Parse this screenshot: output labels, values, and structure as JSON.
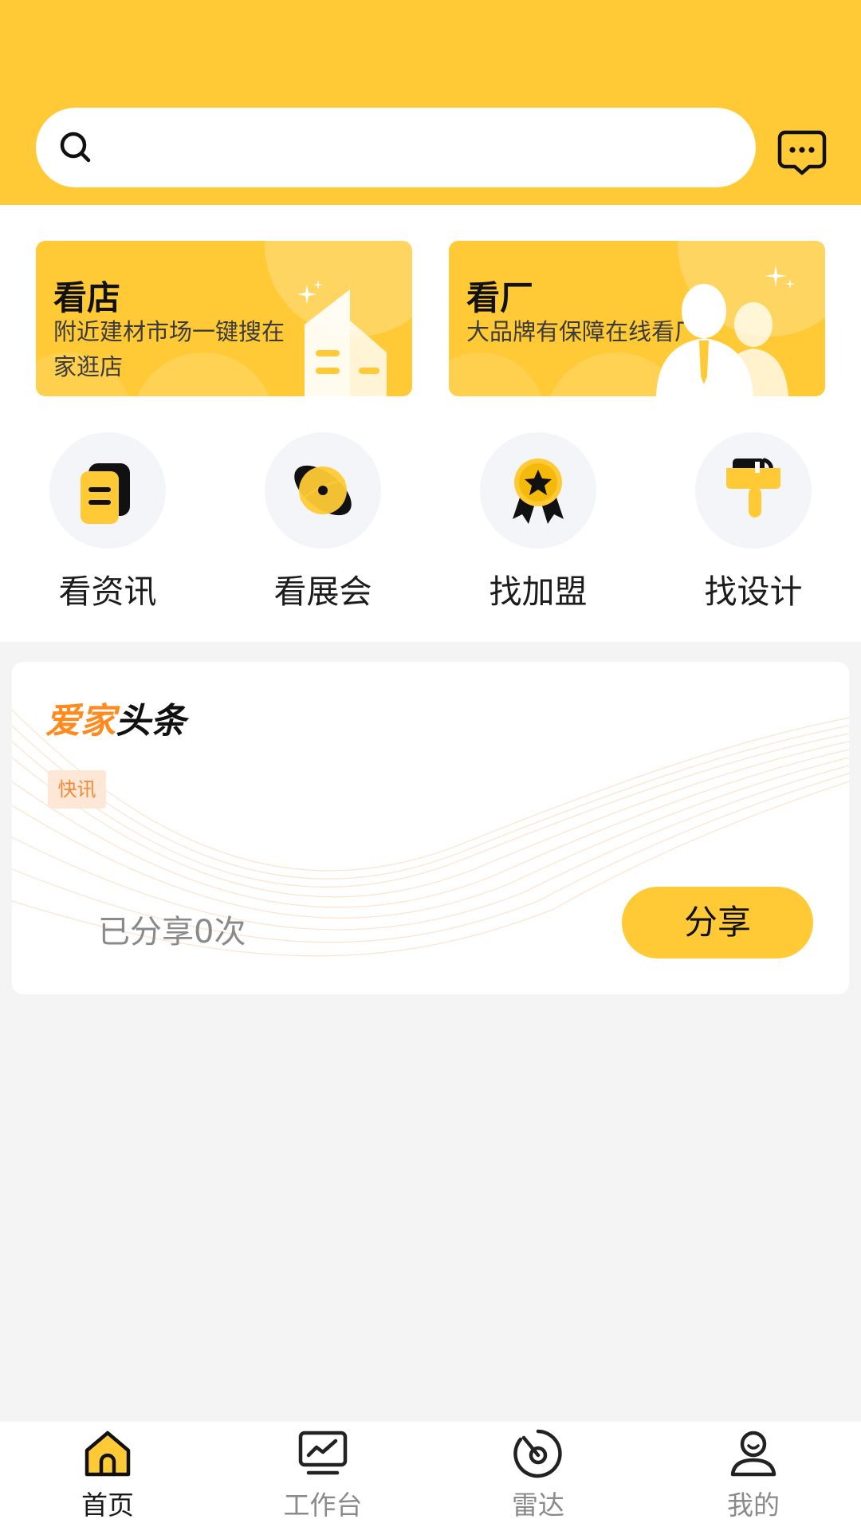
{
  "colors": {
    "accent": "#FFCA36",
    "tag_bg": "#FDE7D6",
    "tag_text": "#F08A3A"
  },
  "header": {
    "search_placeholder": "",
    "search_icon": "search-icon",
    "message_icon": "message-icon"
  },
  "banners": [
    {
      "title": "看店",
      "subtitle": "附近建材市场一键搜在家逛店"
    },
    {
      "title": "看厂",
      "subtitle": "大品牌有保障在线看厂"
    }
  ],
  "categories": [
    {
      "label": "看资讯",
      "icon": "news-icon"
    },
    {
      "label": "看展会",
      "icon": "planet-icon"
    },
    {
      "label": "找加盟",
      "icon": "medal-icon"
    },
    {
      "label": "找设计",
      "icon": "brush-icon"
    }
  ],
  "news": {
    "logo_part1": "爱家",
    "logo_part2": "头条",
    "tag": "快讯",
    "shared_text": "已分享0次",
    "share_label": "分享"
  },
  "tabbar": [
    {
      "label": "首页",
      "icon": "home-icon",
      "active": true
    },
    {
      "label": "工作台",
      "icon": "chart-icon",
      "active": false
    },
    {
      "label": "雷达",
      "icon": "radar-icon",
      "active": false
    },
    {
      "label": "我的",
      "icon": "user-icon",
      "active": false
    }
  ]
}
